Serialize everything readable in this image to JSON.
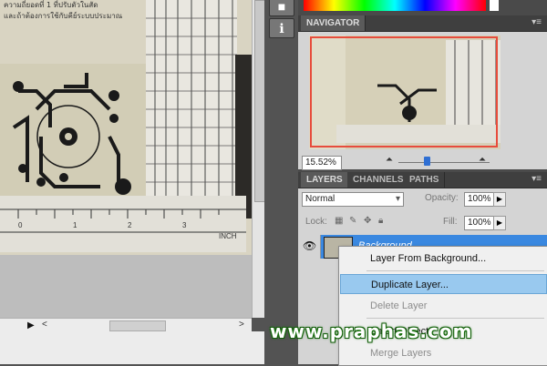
{
  "document": {
    "thai_text_line1": "ความถี่ยอดที่ 1 ที่ปรับตัวในสัด",
    "thai_text_line2": "และถ้าต้องการใช้กับคีย์ระบบประมาณ",
    "ruler_labels": [
      "INCH",
      "0",
      "1",
      "2",
      "3"
    ]
  },
  "navigator": {
    "tab": "NAVIGATOR",
    "zoom": "15.52%"
  },
  "layers": {
    "tabs": [
      "LAYERS",
      "CHANNELS",
      "PATHS"
    ],
    "blend_mode": "Normal",
    "opacity_label": "Opacity:",
    "opacity_value": "100%",
    "lock_label": "Lock:",
    "fill_label": "Fill:",
    "fill_value": "100%",
    "layer_name": "Background"
  },
  "context_menu": {
    "items": [
      {
        "label": "Layer From Background...",
        "enabled": true
      },
      {
        "label": "Duplicate Layer...",
        "enabled": true,
        "highlighted": true
      },
      {
        "label": "Delete Layer",
        "enabled": false
      },
      {
        "label": "Smart Object",
        "enabled": true
      },
      {
        "label": "Merge Layers",
        "enabled": false
      }
    ]
  },
  "watermark": "www.praphas.com",
  "colors": {
    "panel_bg": "#4a4a4a",
    "menu_highlight": "#99c9ef",
    "layer_selected": "#3a88e0",
    "navigator_frame": "#e74c3c"
  }
}
